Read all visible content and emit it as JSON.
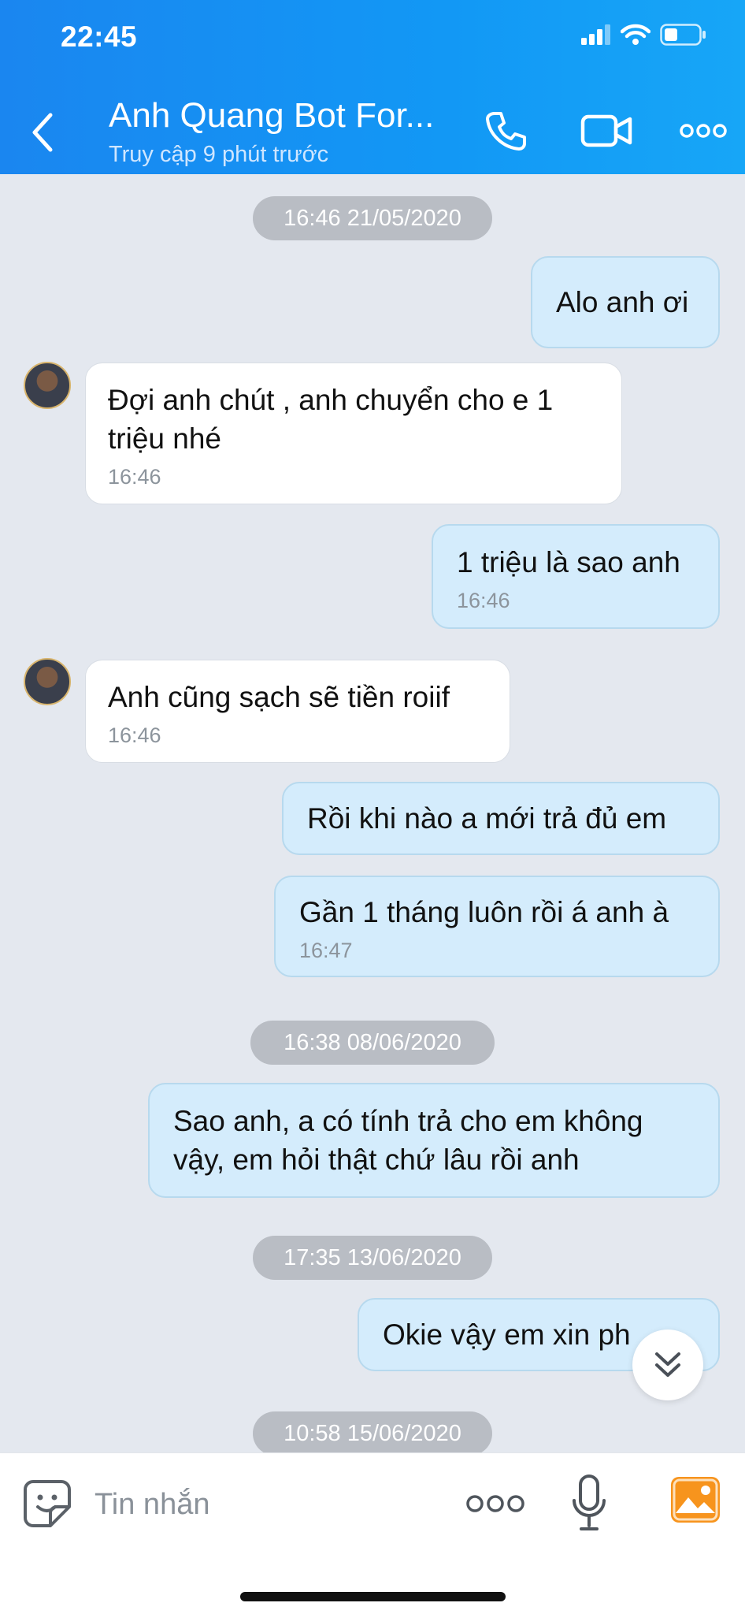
{
  "status_bar": {
    "time": "22:45"
  },
  "header": {
    "contact_name": "Anh Quang Bot For...",
    "last_seen": "Truy cập 9 phút trước",
    "icons": {
      "back": "back-chevron-icon",
      "call": "phone-icon",
      "video": "video-camera-icon",
      "more": "more-dots-icon"
    }
  },
  "messages": [
    {
      "type": "timestamp",
      "text": "16:46 21/05/2020"
    },
    {
      "type": "out",
      "text": "Alo anh ơi"
    },
    {
      "type": "in",
      "text": "Đợi anh chút , anh chuyển cho e 1\ntriệu nhé",
      "time": "16:46"
    },
    {
      "type": "out",
      "text": "1 triệu là sao anh",
      "time": "16:46"
    },
    {
      "type": "in",
      "text": "Anh cũng sạch sẽ tiền roiif",
      "time": "16:46"
    },
    {
      "type": "out",
      "text": "Rồi khi nào a mới trả đủ em"
    },
    {
      "type": "out",
      "text": "Gần 1 tháng luôn rồi á anh à",
      "time": "16:47"
    },
    {
      "type": "timestamp",
      "text": "16:38 08/06/2020"
    },
    {
      "type": "out",
      "text": "Sao anh, a có tính trả cho em không\nvậy, em hỏi thật chứ lâu rồi anh"
    },
    {
      "type": "timestamp",
      "text": "17:35 13/06/2020"
    },
    {
      "type": "out",
      "text": "Okie vậy em xin ph"
    },
    {
      "type": "timestamp",
      "text": "10:58 15/06/2020"
    }
  ],
  "input_bar": {
    "placeholder": "Tin nhắn",
    "icons": {
      "emoji": "emoji-sticker-icon",
      "more": "more-dots-icon",
      "mic": "microphone-icon",
      "image": "image-gallery-icon"
    }
  },
  "colors": {
    "header": "#1a8ff2",
    "bubble_out": "#d4ecfc",
    "bubble_in": "#ffffff",
    "chat_bg": "#e4e8ef",
    "image_icon": "#f7941d"
  }
}
